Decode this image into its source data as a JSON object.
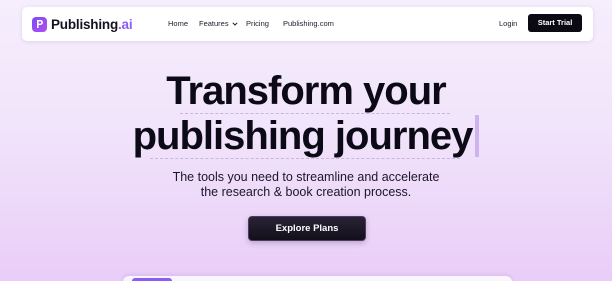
{
  "nav": {
    "brand_name": "Publishing",
    "brand_suffix": ".ai",
    "links": [
      {
        "label": "Home"
      },
      {
        "label": "Features"
      },
      {
        "label": "Pricing"
      },
      {
        "label": "Publishing.com"
      }
    ],
    "login_label": "Login",
    "cta_label": "Start Trial"
  },
  "hero": {
    "title_line1": "Transform your",
    "title_line2": "publishing journey",
    "subtitle_line1": "The tools you need to streamline and accelerate",
    "subtitle_line2": "the research & book creation process.",
    "cta_label": "Explore Plans"
  },
  "colors": {
    "brand_accent": "#8b5cf6",
    "button_dark": "#0b0a12",
    "background_top": "#f5eefc",
    "background_bottom": "#e9cdf8"
  },
  "icons": {
    "logo": "publishing-logo-icon",
    "features_dropdown": "chevron-down-icon"
  }
}
